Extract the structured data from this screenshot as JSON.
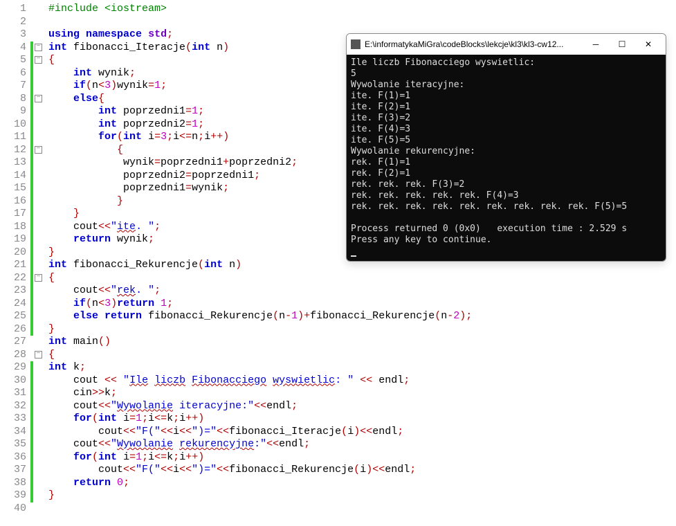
{
  "editor": {
    "lines": [
      {
        "n": 1,
        "html": "<span class='pp'>#include &lt;iostream&gt;</span>"
      },
      {
        "n": 2,
        "html": ""
      },
      {
        "n": 3,
        "html": "<span class='kw'>using</span> <span class='kw'>namespace</span> <span class='ty'>std</span><span class='op'>;</span>"
      },
      {
        "n": 4,
        "html": "<span class='kw'>int</span> fibonacci_Iteracje<span class='op'>(</span><span class='kw'>int</span> n<span class='op'>)</span>",
        "bar": true,
        "fold": true
      },
      {
        "n": 5,
        "html": "<span class='op'>{</span>",
        "bar": true,
        "fold": true
      },
      {
        "n": 6,
        "html": "    <span class='kw'>int</span> wynik<span class='op'>;</span>",
        "bar": true
      },
      {
        "n": 7,
        "html": "    <span class='kw'>if</span><span class='op'>(</span>n<span class='op'>&lt;</span><span class='num'>3</span><span class='op'>)</span>wynik<span class='op'>=</span><span class='num'>1</span><span class='op'>;</span>",
        "bar": true
      },
      {
        "n": 8,
        "html": "    <span class='kw'>else</span><span class='op'>{</span>",
        "bar": true,
        "fold": true
      },
      {
        "n": 9,
        "html": "        <span class='kw'>int</span> poprzedni1<span class='op'>=</span><span class='num'>1</span><span class='op'>;</span>",
        "bar": true
      },
      {
        "n": 10,
        "html": "        <span class='kw'>int</span> poprzedni2<span class='op'>=</span><span class='num'>1</span><span class='op'>;</span>",
        "bar": true
      },
      {
        "n": 11,
        "html": "        <span class='kw'>for</span><span class='op'>(</span><span class='kw'>int</span> i<span class='op'>=</span><span class='num'>3</span><span class='op'>;</span>i<span class='op'>&lt;=</span>n<span class='op'>;</span>i<span class='op'>++)</span>",
        "bar": true
      },
      {
        "n": 12,
        "html": "           <span class='op'>{</span>",
        "bar": true,
        "fold": true
      },
      {
        "n": 13,
        "html": "            wynik<span class='op'>=</span>poprzedni1<span class='op'>+</span>poprzedni2<span class='op'>;</span>",
        "bar": true
      },
      {
        "n": 14,
        "html": "            poprzedni2<span class='op'>=</span>poprzedni1<span class='op'>;</span>",
        "bar": true
      },
      {
        "n": 15,
        "html": "            poprzedni1<span class='op'>=</span>wynik<span class='op'>;</span>",
        "bar": true
      },
      {
        "n": 16,
        "html": "           <span class='op'>}</span>",
        "bar": true
      },
      {
        "n": 17,
        "html": "    <span class='op'>}</span>",
        "bar": true
      },
      {
        "n": 18,
        "html": "    cout<span class='op'>&lt;&lt;</span><span class='str'>\"<span class='sq'>ite</span>. \"</span><span class='op'>;</span>",
        "bar": true
      },
      {
        "n": 19,
        "html": "    <span class='kw'>return</span> wynik<span class='op'>;</span>",
        "bar": true
      },
      {
        "n": 20,
        "html": "<span class='op'>}</span>",
        "bar": true
      },
      {
        "n": 21,
        "html": "<span class='kw'>int</span> fibonacci_Rekurencje<span class='op'>(</span><span class='kw'>int</span> n<span class='op'>)</span>",
        "bar": true
      },
      {
        "n": 22,
        "html": "<span class='op'>{</span>",
        "bar": true,
        "fold": true
      },
      {
        "n": 23,
        "html": "    cout<span class='op'>&lt;&lt;</span><span class='str'>\"<span class='sq'>rek</span>. \"</span><span class='op'>;</span>",
        "bar": true
      },
      {
        "n": 24,
        "html": "    <span class='kw'>if</span><span class='op'>(</span>n<span class='op'>&lt;</span><span class='num'>3</span><span class='op'>)</span><span class='kw'>return</span> <span class='num'>1</span><span class='op'>;</span>",
        "bar": true
      },
      {
        "n": 25,
        "html": "    <span class='kw'>else</span> <span class='kw'>return</span> fibonacci_Rekurencje<span class='op'>(</span>n<span class='op'>-</span><span class='num'>1</span><span class='op'>)+</span>fibonacci_Rekurencje<span class='op'>(</span>n<span class='op'>-</span><span class='num'>2</span><span class='op'>);</span>",
        "bar": true
      },
      {
        "n": 26,
        "html": "<span class='op'>}</span>",
        "bar": true
      },
      {
        "n": 27,
        "html": "<span class='kw'>int</span> main<span class='op'>()</span>"
      },
      {
        "n": 28,
        "html": "<span class='op'>{</span>",
        "fold": true
      },
      {
        "n": 29,
        "html": "<span class='kw'>int</span> k<span class='op'>;</span>",
        "bar": true
      },
      {
        "n": 30,
        "html": "    cout <span class='op'>&lt;&lt;</span> <span class='str'>\"<span class='sq'>Ile</span> <span class='sq'>liczb</span> <span class='sq'>Fibonacciego</span> <span class='sq'>wyswietlic</span>: \"</span> <span class='op'>&lt;&lt;</span> endl<span class='op'>;</span>",
        "bar": true
      },
      {
        "n": 31,
        "html": "    cin<span class='op'>&gt;&gt;</span>k<span class='op'>;</span>",
        "bar": true
      },
      {
        "n": 32,
        "html": "    cout<span class='op'>&lt;&lt;</span><span class='str'>\"<span class='sq'>Wywolanie</span> iteracyjne:\"</span><span class='op'>&lt;&lt;</span>endl<span class='op'>;</span>",
        "bar": true
      },
      {
        "n": 33,
        "html": "    <span class='kw'>for</span><span class='op'>(</span><span class='kw'>int</span> i<span class='op'>=</span><span class='num'>1</span><span class='op'>;</span>i<span class='op'>&lt;=</span>k<span class='op'>;</span>i<span class='op'>++)</span>",
        "bar": true
      },
      {
        "n": 34,
        "html": "        cout<span class='op'>&lt;&lt;</span><span class='str'>\"F(\"</span><span class='op'>&lt;&lt;</span>i<span class='op'>&lt;&lt;</span><span class='str'>\")=\"</span><span class='op'>&lt;&lt;</span>fibonacci_Iteracje<span class='op'>(</span>i<span class='op'>)&lt;&lt;</span>endl<span class='op'>;</span>",
        "bar": true
      },
      {
        "n": 35,
        "html": "    cout<span class='op'>&lt;&lt;</span><span class='str'>\"<span class='sq'>Wywolanie</span> <span class='sq'>rekurencyjne</span>:\"</span><span class='op'>&lt;&lt;</span>endl<span class='op'>;</span>",
        "bar": true
      },
      {
        "n": 36,
        "html": "    <span class='kw'>for</span><span class='op'>(</span><span class='kw'>int</span> i<span class='op'>=</span><span class='num'>1</span><span class='op'>;</span>i<span class='op'>&lt;=</span>k<span class='op'>;</span>i<span class='op'>++)</span>",
        "bar": true
      },
      {
        "n": 37,
        "html": "        cout<span class='op'>&lt;&lt;</span><span class='str'>\"F(\"</span><span class='op'>&lt;&lt;</span>i<span class='op'>&lt;&lt;</span><span class='str'>\")=\"</span><span class='op'>&lt;&lt;</span>fibonacci_Rekurencje<span class='op'>(</span>i<span class='op'>)&lt;&lt;</span>endl<span class='op'>;</span>",
        "bar": true
      },
      {
        "n": 38,
        "html": "    <span class='kw'>return</span> <span class='num'>0</span><span class='op'>;</span>",
        "bar": true
      },
      {
        "n": 39,
        "html": "<span class='op'>}</span>",
        "bar": true
      },
      {
        "n": 40,
        "html": ""
      }
    ]
  },
  "terminal": {
    "title": "E:\\informatykaMiGra\\codeBlocks\\lekcje\\kl3\\kl3-cw12...",
    "output": "Ile liczb Fibonacciego wyswietlic:\n5\nWywolanie iteracyjne:\nite. F(1)=1\nite. F(2)=1\nite. F(3)=2\nite. F(4)=3\nite. F(5)=5\nWywolanie rekurencyjne:\nrek. F(1)=1\nrek. F(2)=1\nrek. rek. rek. F(3)=2\nrek. rek. rek. rek. rek. F(4)=3\nrek. rek. rek. rek. rek. rek. rek. rek. rek. F(5)=5\n\nProcess returned 0 (0x0)   execution time : 2.529 s\nPress any key to continue."
  }
}
